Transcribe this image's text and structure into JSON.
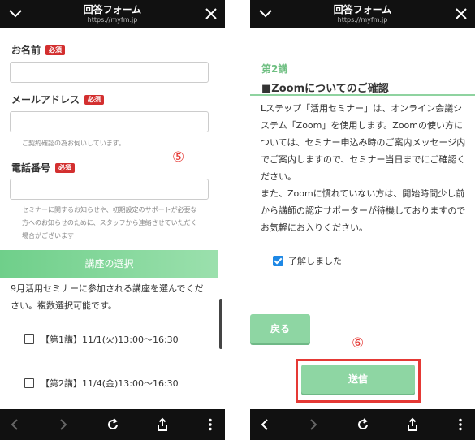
{
  "left_screen": {
    "header": {
      "title": "回答フォーム",
      "url": "https://myfm.jp"
    },
    "fields": [
      {
        "label": "お名前",
        "required_badge": "必須"
      },
      {
        "label": "メールアドレス",
        "required_badge": "必須",
        "note": "ご契約確認の為お伺いしています。"
      },
      {
        "label": "電話番号",
        "required_badge": "必須",
        "note": "セミナーに関するお知らせや、初期設定のサポートが必要な方へのお知らせのために、スタッフから連絡させていただく場合がございます"
      }
    ],
    "step_marker": "⑤",
    "section": {
      "title": "講座の選択",
      "description": "9月活用セミナーに参加される講座を選んでください。複数選択可能です。",
      "options": [
        {
          "label": "【第1講】11/1(火)13:00〜16:30",
          "checked": false
        },
        {
          "label": "【第2講】11/4(金)13:00〜16:30",
          "checked": false
        }
      ]
    }
  },
  "right_screen": {
    "header": {
      "title": "回答フォーム",
      "url": "https://myfm.jp"
    },
    "course_title": "第2講",
    "heading": "■Zoomについてのご確認",
    "body": "Lステップ「活用セミナー」は、オンライン会議システム「Zoom」を使用します。Zoomの使い方については、セミナー申込み時のご案内メッセージ内でご案内しますので、セミナー当日までにご確認ください。\nまた、Zoomに慣れていない方は、開始時間少し前から講師の認定サポーターが待機しておりますのでお気軽にお入りください。",
    "agree_label": "了解しました",
    "agree_checked": true,
    "back_label": "戻る",
    "submit_label": "送信",
    "step_marker": "⑥"
  },
  "colors": {
    "accent_green": "#8ed6a3",
    "required_red": "#d32f2f",
    "annotation_red": "#e53935",
    "checkbox_blue": "#1e88e5",
    "bar_black": "#111111"
  },
  "icons": [
    "chevron-down-icon",
    "close-icon",
    "back-arrow-icon",
    "forward-arrow-icon",
    "reload-icon",
    "share-icon",
    "more-vert-icon"
  ]
}
